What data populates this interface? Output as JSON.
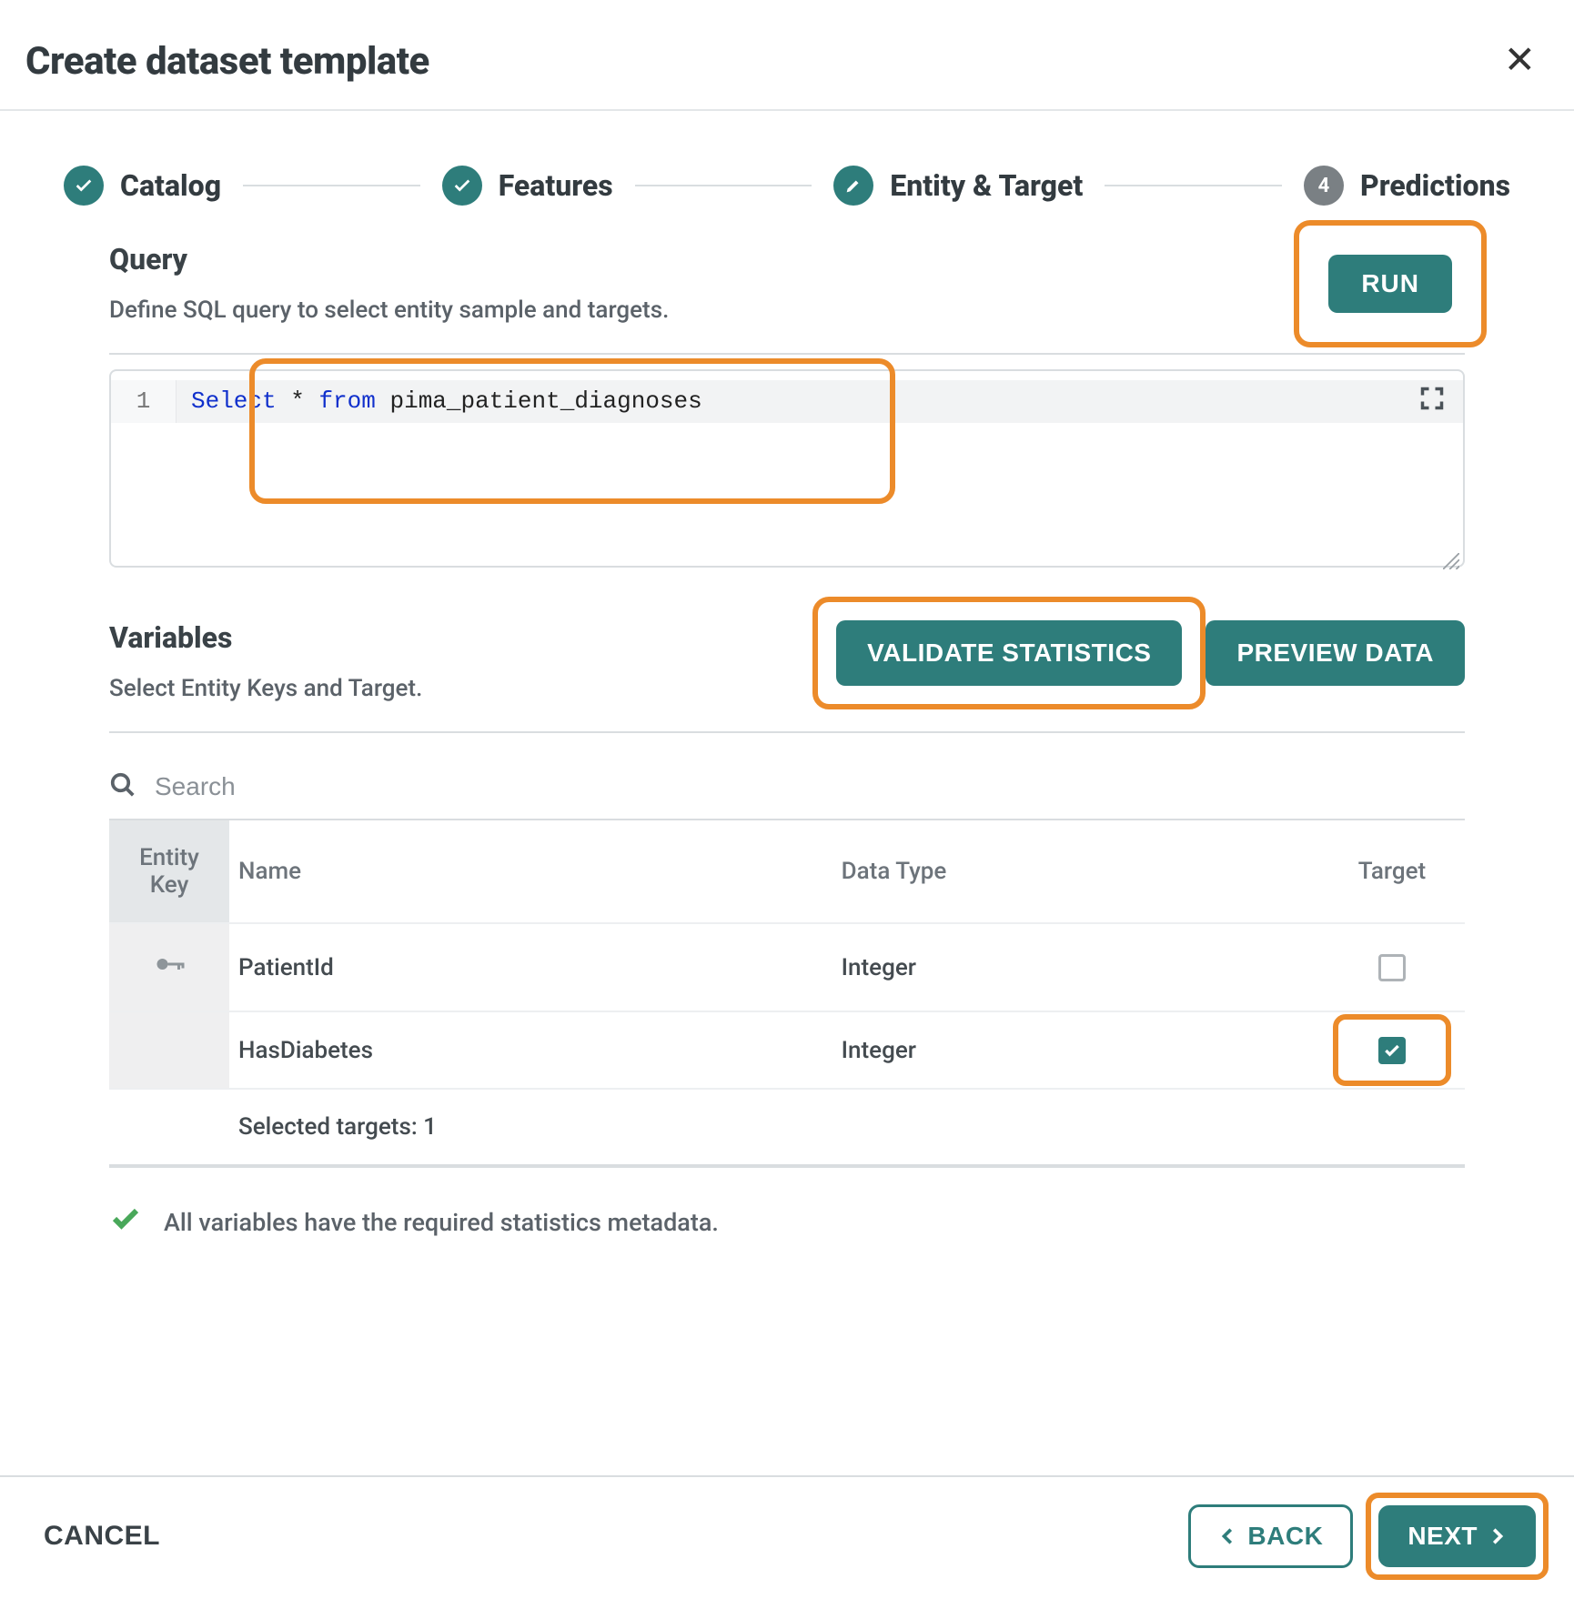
{
  "modal": {
    "title": "Create dataset template"
  },
  "stepper": {
    "steps": [
      {
        "label": "Catalog",
        "state": "done"
      },
      {
        "label": "Features",
        "state": "done"
      },
      {
        "label": "Entity & Target",
        "state": "current"
      },
      {
        "label": "Predictions",
        "state": "upcoming",
        "num": "4"
      }
    ]
  },
  "query": {
    "heading": "Query",
    "subheading": "Define SQL query to select entity sample and targets.",
    "run_label": "RUN",
    "line_num": "1",
    "sql": {
      "kw_select": "Select",
      "star": "*",
      "kw_from": "from",
      "table": "pima_patient_diagnoses"
    }
  },
  "variables": {
    "heading": "Variables",
    "subheading": "Select Entity Keys and Target.",
    "validate_label": "VALIDATE STATISTICS",
    "preview_label": "PREVIEW DATA",
    "search_placeholder": "Search",
    "columns": {
      "entity_key": "Entity Key",
      "name": "Name",
      "data_type": "Data Type",
      "target": "Target"
    },
    "rows": [
      {
        "name": "PatientId",
        "data_type": "Integer",
        "is_key": true,
        "is_target": false
      },
      {
        "name": "HasDiabetes",
        "data_type": "Integer",
        "is_key": false,
        "is_target": true
      }
    ],
    "selected_targets_label": "Selected targets: 1",
    "status_ok": "All variables have the required statistics metadata."
  },
  "footer": {
    "cancel": "CANCEL",
    "back": "BACK",
    "next": "NEXT"
  },
  "highlight_color": "#ec8b2a"
}
